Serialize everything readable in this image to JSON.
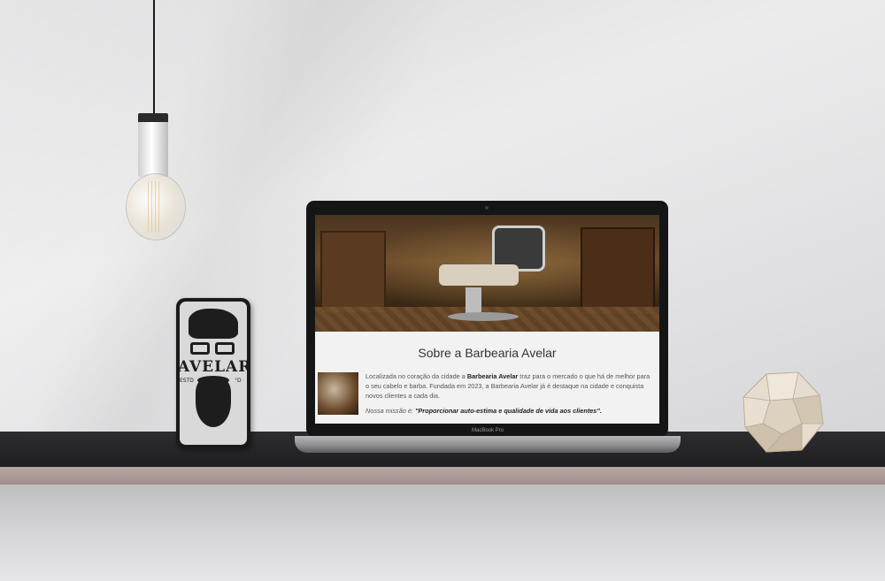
{
  "laptop": {
    "brand": "MacBook Pro",
    "page": {
      "title": "Sobre a Barbearia Avelar",
      "paragraph_part1": "Localizada no coração da cidade a ",
      "paragraph_bold": "Barbearia Avelar",
      "paragraph_part2": " traz para o mercado o que há de melhor para o seu cabelo e barba. Fundada em 2023, a Barbearia Avelar já é destaque na cidade e conquista novos clientes a cada dia.",
      "mission_label": "Nossa missão é: ",
      "mission_text": "\"Proporcionar auto-estima e qualidade de vida aos clientes\"."
    }
  },
  "phone": {
    "logo_text": "AVELAR",
    "logo_est_left": "ESTD",
    "logo_est_right": "°D"
  },
  "colors": {
    "wall": "#e4e4e6",
    "shelf": "#232325",
    "shelf_edge": "#ad9c97",
    "screen_bg": "#f2f2f2"
  }
}
